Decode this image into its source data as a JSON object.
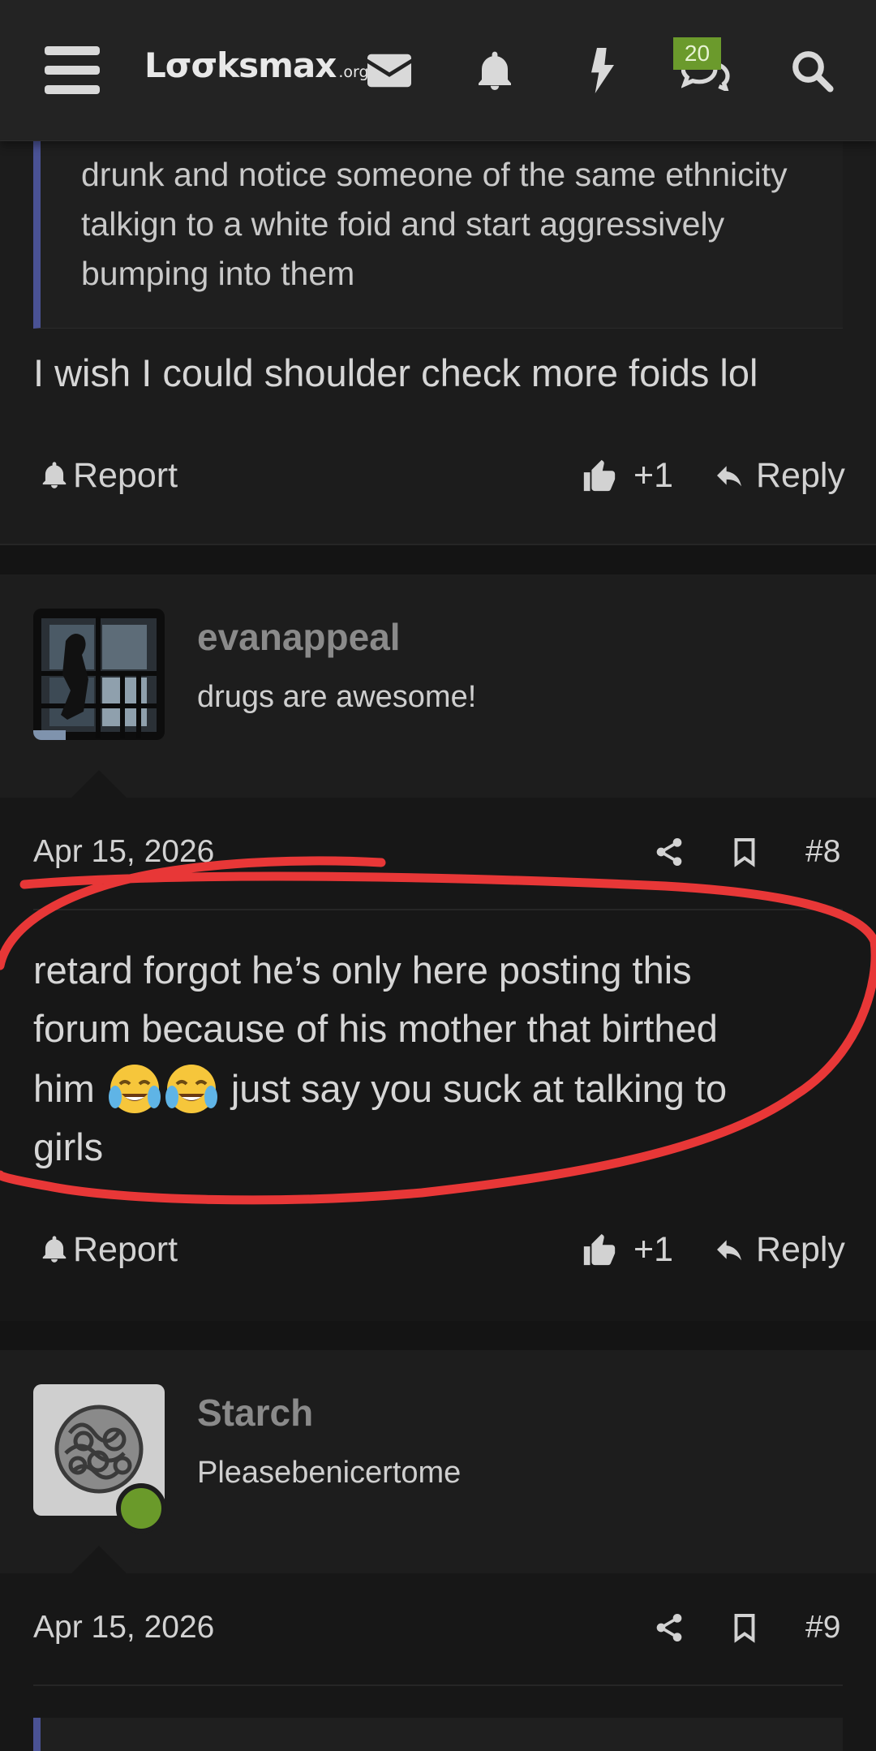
{
  "header": {
    "logo_main": "Lσσksmax",
    "logo_suffix": ".org",
    "badge_count": "20"
  },
  "prev_post": {
    "quote_lines": "drunk and notice someone of the same ethnicity talkign to a white foid and start aggressively bumping into them",
    "body": "I wish I could shoulder check more foids lol",
    "report_label": "Report",
    "like_count": "+1",
    "reply_label": "Reply"
  },
  "post8": {
    "username": "evanappeal",
    "user_title": "drugs are awesome!",
    "date": "Apr 15, 2026",
    "number": "#8",
    "body_line1": "retard forgot he’s only here posting this",
    "body_line2": "forum because of his mother that birthed",
    "body_line3a": "him",
    "body_line3b": "just say you suck at talking to",
    "body_line4": "girls",
    "report_label": "Report",
    "like_count": "+1",
    "reply_label": "Reply"
  },
  "post9": {
    "username": "Starch",
    "user_title": "Pleasebenicertome",
    "date": "Apr 15, 2026",
    "number": "#9"
  },
  "colors": {
    "background": "#1a1a1a",
    "quote_bar": "#4a5294",
    "badge": "#6b9a2c",
    "online": "#6a9a2a",
    "annotation": "#ff3b3b"
  }
}
